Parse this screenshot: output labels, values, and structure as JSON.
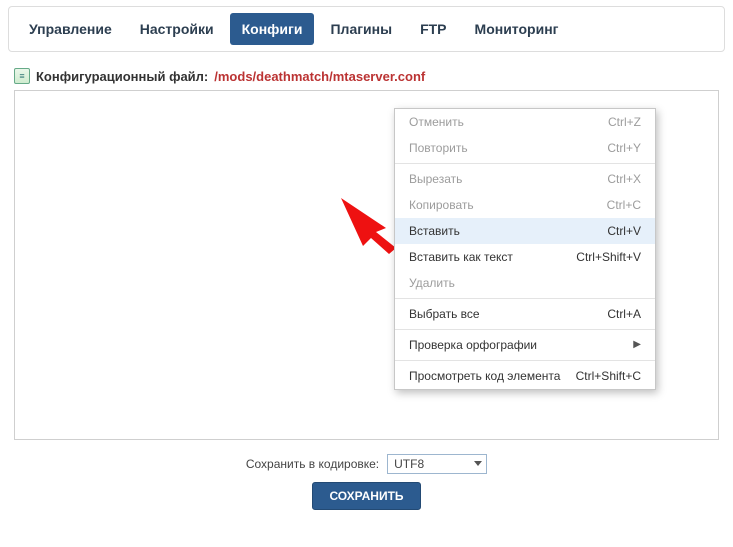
{
  "nav": {
    "items": [
      {
        "label": "Управление",
        "active": false
      },
      {
        "label": "Настройки",
        "active": false
      },
      {
        "label": "Конфиги",
        "active": true
      },
      {
        "label": "Плагины",
        "active": false
      },
      {
        "label": "FTP",
        "active": false
      },
      {
        "label": "Мониторинг",
        "active": false
      }
    ]
  },
  "path": {
    "label": "Конфигурационный файл:",
    "value": "/mods/deathmatch/mtaserver.conf"
  },
  "context_menu": [
    {
      "label": "Отменить",
      "shortcut": "Ctrl+Z",
      "disabled": true
    },
    {
      "label": "Повторить",
      "shortcut": "Ctrl+Y",
      "disabled": true
    },
    {
      "sep": true
    },
    {
      "label": "Вырезать",
      "shortcut": "Ctrl+X",
      "disabled": true
    },
    {
      "label": "Копировать",
      "shortcut": "Ctrl+C",
      "disabled": true
    },
    {
      "label": "Вставить",
      "shortcut": "Ctrl+V",
      "highlight": true
    },
    {
      "label": "Вставить как текст",
      "shortcut": "Ctrl+Shift+V"
    },
    {
      "label": "Удалить",
      "shortcut": "",
      "disabled": true
    },
    {
      "sep": true
    },
    {
      "label": "Выбрать все",
      "shortcut": "Ctrl+A"
    },
    {
      "sep": true
    },
    {
      "label": "Проверка орфографии",
      "shortcut": "",
      "submenu": true
    },
    {
      "sep": true
    },
    {
      "label": "Просмотреть код элемента",
      "shortcut": "Ctrl+Shift+C"
    }
  ],
  "footer": {
    "encoding_label": "Сохранить в кодировке:",
    "encoding_value": "UTF8",
    "save_label": "СОХРАНИТЬ"
  }
}
